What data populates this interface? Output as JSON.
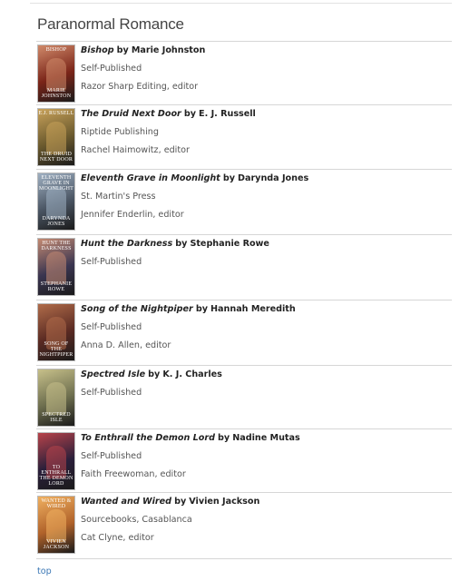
{
  "section": {
    "title": "Paranormal Romance"
  },
  "by_word": "by",
  "books": [
    {
      "title": "Bishop",
      "author": "Marie Johnston",
      "publisher": "Self-Published",
      "editor": "Razor Sharp Editing, editor",
      "cover": {
        "top_text": "BISHOP",
        "bottom_text": "Marie Johnston",
        "bg": "#7a2418",
        "accent": "#d08a6a"
      }
    },
    {
      "title": "The Druid Next Door",
      "author": "E. J. Russell",
      "publisher": "Riptide Publishing",
      "editor": "Rachel Haimowitz, editor",
      "cover": {
        "top_text": "E.J. RUSSELL",
        "bottom_text": "THE DRUID NEXT DOOR",
        "bg": "#6b5a2e",
        "accent": "#c9a25a"
      }
    },
    {
      "title": "Eleventh Grave in Moonlight",
      "author": "Darynda Jones",
      "publisher": "St. Martin's Press",
      "editor": "Jennifer Enderlin, editor",
      "cover": {
        "top_text": "Eleventh Grave in Moonlight",
        "bottom_text": "DARYNDA JONES",
        "bg": "#4a5563",
        "accent": "#9fb0c2"
      }
    },
    {
      "title": "Hunt the Darkness",
      "author": "Stephanie Rowe",
      "publisher": "Self-Published",
      "editor": "",
      "cover": {
        "top_text": "HUNT THE DARKNESS",
        "bottom_text": "STEPHANIE ROWE",
        "bg": "#3a3550",
        "accent": "#c48a72"
      }
    },
    {
      "title": "Song of the Nightpiper",
      "author": "Hannah Meredith",
      "publisher": "Self-Published",
      "editor": "Anna D. Allen, editor",
      "cover": {
        "top_text": "",
        "bottom_text": "Song of the Nightpiper",
        "bg": "#5a2a22",
        "accent": "#b06c4a"
      }
    },
    {
      "title": "Spectred Isle",
      "author": "K. J. Charles",
      "publisher": "Self-Published",
      "editor": "",
      "cover": {
        "top_text": "",
        "bottom_text": "SPECTRED ISLE",
        "bg": "#6d6e4e",
        "accent": "#c7c08a"
      }
    },
    {
      "title": "To Enthrall the Demon Lord",
      "author": "Nadine Mutas",
      "publisher": "Self-Published",
      "editor": "Faith Freewoman, editor",
      "cover": {
        "top_text": "",
        "bottom_text": "TO ENTHRALL THE DEMON LORD",
        "bg": "#2a1f3a",
        "accent": "#b8434a"
      }
    },
    {
      "title": "Wanted and Wired",
      "author": "Vivien Jackson",
      "publisher": "Sourcebooks, Casablanca",
      "editor": "Cat Clyne, editor",
      "cover": {
        "top_text": "WANTED & WIRED",
        "bottom_text": "VIVIEN JACKSON",
        "bg": "#b0622a",
        "accent": "#f0b060"
      }
    }
  ],
  "footer": {
    "top_link": "top"
  }
}
